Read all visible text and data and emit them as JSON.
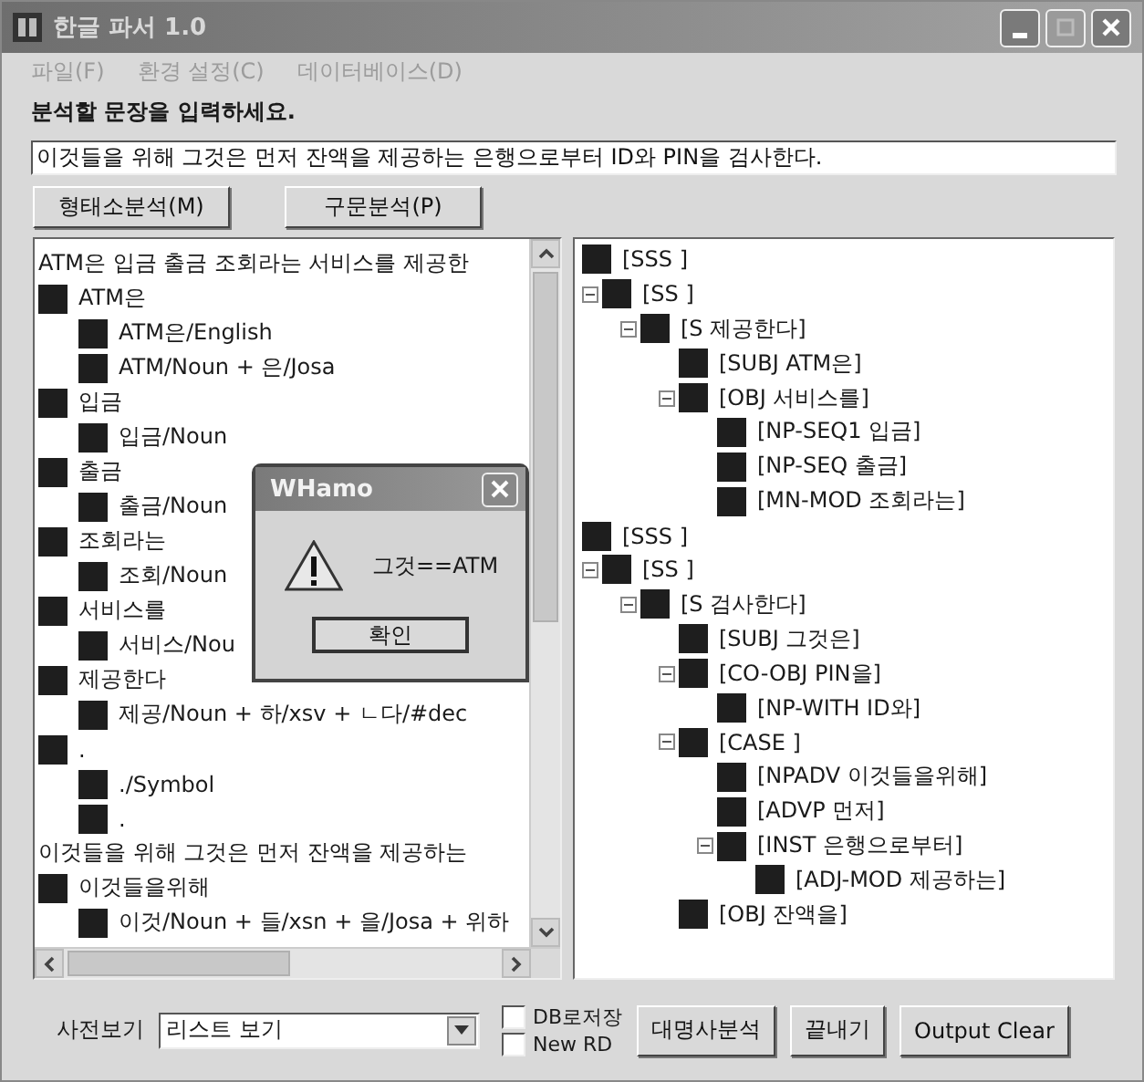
{
  "window": {
    "title": "한글 파서 1.0"
  },
  "menu": [
    "파일(F)",
    "환경 설정(C)",
    "데이터베이스(D)"
  ],
  "prompt": "분석할 문장을 입력하세요.",
  "sentence_input": {
    "value": "이것들을 위해 그것은 먼저 잔액을 제공하는 은행으로부터 ID와 PIN을 검사한다."
  },
  "analysis_buttons": [
    "형태소분석(M)",
    "구문분석(P)"
  ],
  "morph_tree": [
    {
      "kind": "sentence",
      "label": "ATM은 입금 출금 조회라는 서비스를 제공한"
    },
    {
      "kind": "node",
      "label": "ATM은",
      "children": [
        {
          "kind": "node",
          "label": "ATM은/English"
        },
        {
          "kind": "node",
          "label": "ATM/Noun + 은/Josa"
        }
      ]
    },
    {
      "kind": "node",
      "label": "입금",
      "children": [
        {
          "kind": "node",
          "label": "입금/Noun"
        }
      ]
    },
    {
      "kind": "node",
      "label": "출금",
      "children": [
        {
          "kind": "node",
          "label": "출금/Noun"
        }
      ]
    },
    {
      "kind": "node",
      "label": "조회라는",
      "children": [
        {
          "kind": "node",
          "label": "조회/Noun"
        }
      ]
    },
    {
      "kind": "node",
      "label": "서비스를",
      "children": [
        {
          "kind": "node",
          "label": "서비스/Nou"
        }
      ]
    },
    {
      "kind": "node",
      "label": "제공한다",
      "children": [
        {
          "kind": "node",
          "label": "제공/Noun + 하/xsv + ㄴ다/#dec"
        }
      ]
    },
    {
      "kind": "node",
      "label": ".",
      "children": [
        {
          "kind": "node",
          "label": "./Symbol"
        },
        {
          "kind": "node",
          "label": "."
        }
      ]
    },
    {
      "kind": "sentence",
      "label": "이것들을 위해 그것은 먼저 잔액을 제공하는"
    },
    {
      "kind": "node",
      "label": "이것들을위해",
      "children": [
        {
          "kind": "node",
          "label": "이것/Noun + 들/xsn + 을/Josa + 위하"
        }
      ]
    }
  ],
  "parse_tree": [
    {
      "label": "[SSS ]",
      "children": [
        {
          "label": "[SS ]",
          "expanded": true,
          "children": [
            {
              "label": "[S 제공한다]",
              "expanded": true,
              "children": [
                {
                  "label": "[SUBJ ATM은]"
                },
                {
                  "label": "[OBJ 서비스를]",
                  "expanded": true,
                  "children": [
                    {
                      "label": "[NP-SEQ1 입금]"
                    },
                    {
                      "label": "[NP-SEQ 출금]"
                    },
                    {
                      "label": "[MN-MOD 조회라는]"
                    }
                  ]
                }
              ]
            }
          ]
        }
      ]
    },
    {
      "label": "[SSS ]",
      "children": [
        {
          "label": "[SS ]",
          "expanded": true,
          "children": [
            {
              "label": "[S 검사한다]",
              "expanded": true,
              "children": [
                {
                  "label": "[SUBJ 그것은]"
                },
                {
                  "label": "[CO-OBJ PIN을]",
                  "expanded": true,
                  "children": [
                    {
                      "label": "[NP-WITH ID와]"
                    }
                  ]
                },
                {
                  "label": "[CASE ]",
                  "expanded": true,
                  "children": [
                    {
                      "label": "[NPADV 이것들을위해]"
                    },
                    {
                      "label": "[ADVP 먼저]"
                    },
                    {
                      "label": "[INST 은행으로부터]",
                      "expanded": true,
                      "children": [
                        {
                          "label": "[ADJ-MOD 제공하는]"
                        }
                      ]
                    }
                  ]
                },
                {
                  "label": "[OBJ 잔액을]"
                }
              ]
            }
          ]
        }
      ]
    }
  ],
  "dialog": {
    "title": "WHamo",
    "message": "그것==ATM",
    "button": "확인"
  },
  "bottom": {
    "dictionary_label": "사전보기",
    "dictionary_view": "리스트 보기",
    "checkboxes": [
      {
        "label": "DB로저장",
        "checked": false
      },
      {
        "label": "New RD",
        "checked": false
      }
    ],
    "buttons": [
      "대명사분석",
      "끝내기",
      "Output Clear"
    ]
  }
}
